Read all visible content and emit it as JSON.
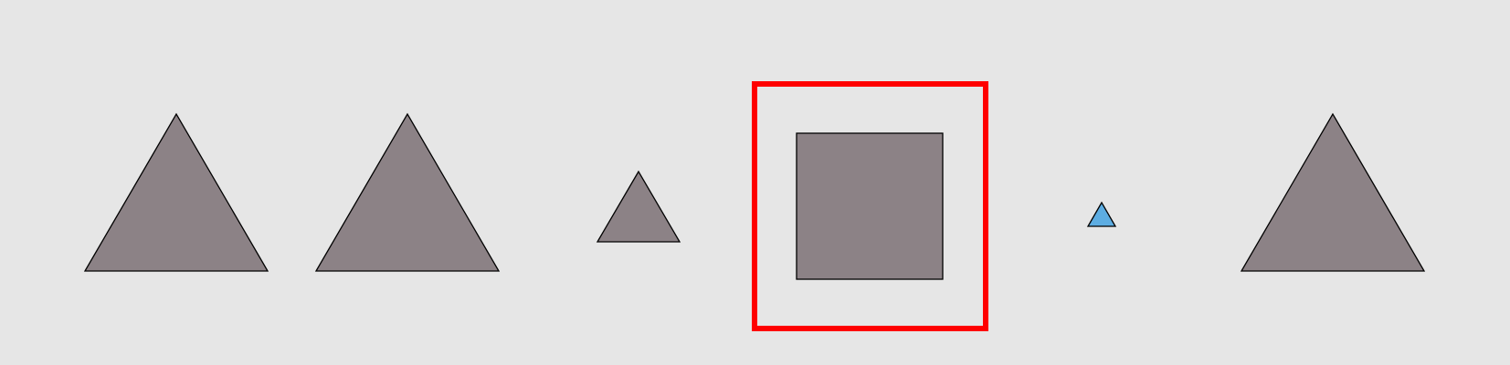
{
  "canvas": {
    "background": "#e6e6e6"
  },
  "shapes": [
    {
      "id": "shape-1",
      "kind": "triangle",
      "size": "large",
      "fill": "#8c8286"
    },
    {
      "id": "shape-2",
      "kind": "triangle",
      "size": "large",
      "fill": "#8c8286"
    },
    {
      "id": "shape-3",
      "kind": "triangle",
      "size": "medium",
      "fill": "#8c8286"
    },
    {
      "id": "shape-4",
      "kind": "square",
      "size": "large",
      "fill": "#8c8286",
      "highlighted": true
    },
    {
      "id": "shape-5",
      "kind": "triangle",
      "size": "small",
      "fill": "#5dade2"
    },
    {
      "id": "shape-6",
      "kind": "triangle",
      "size": "large",
      "fill": "#8c8286"
    }
  ],
  "highlight": {
    "stroke": "#ff0000",
    "target": "shape-4"
  },
  "outline_color": "#000000"
}
